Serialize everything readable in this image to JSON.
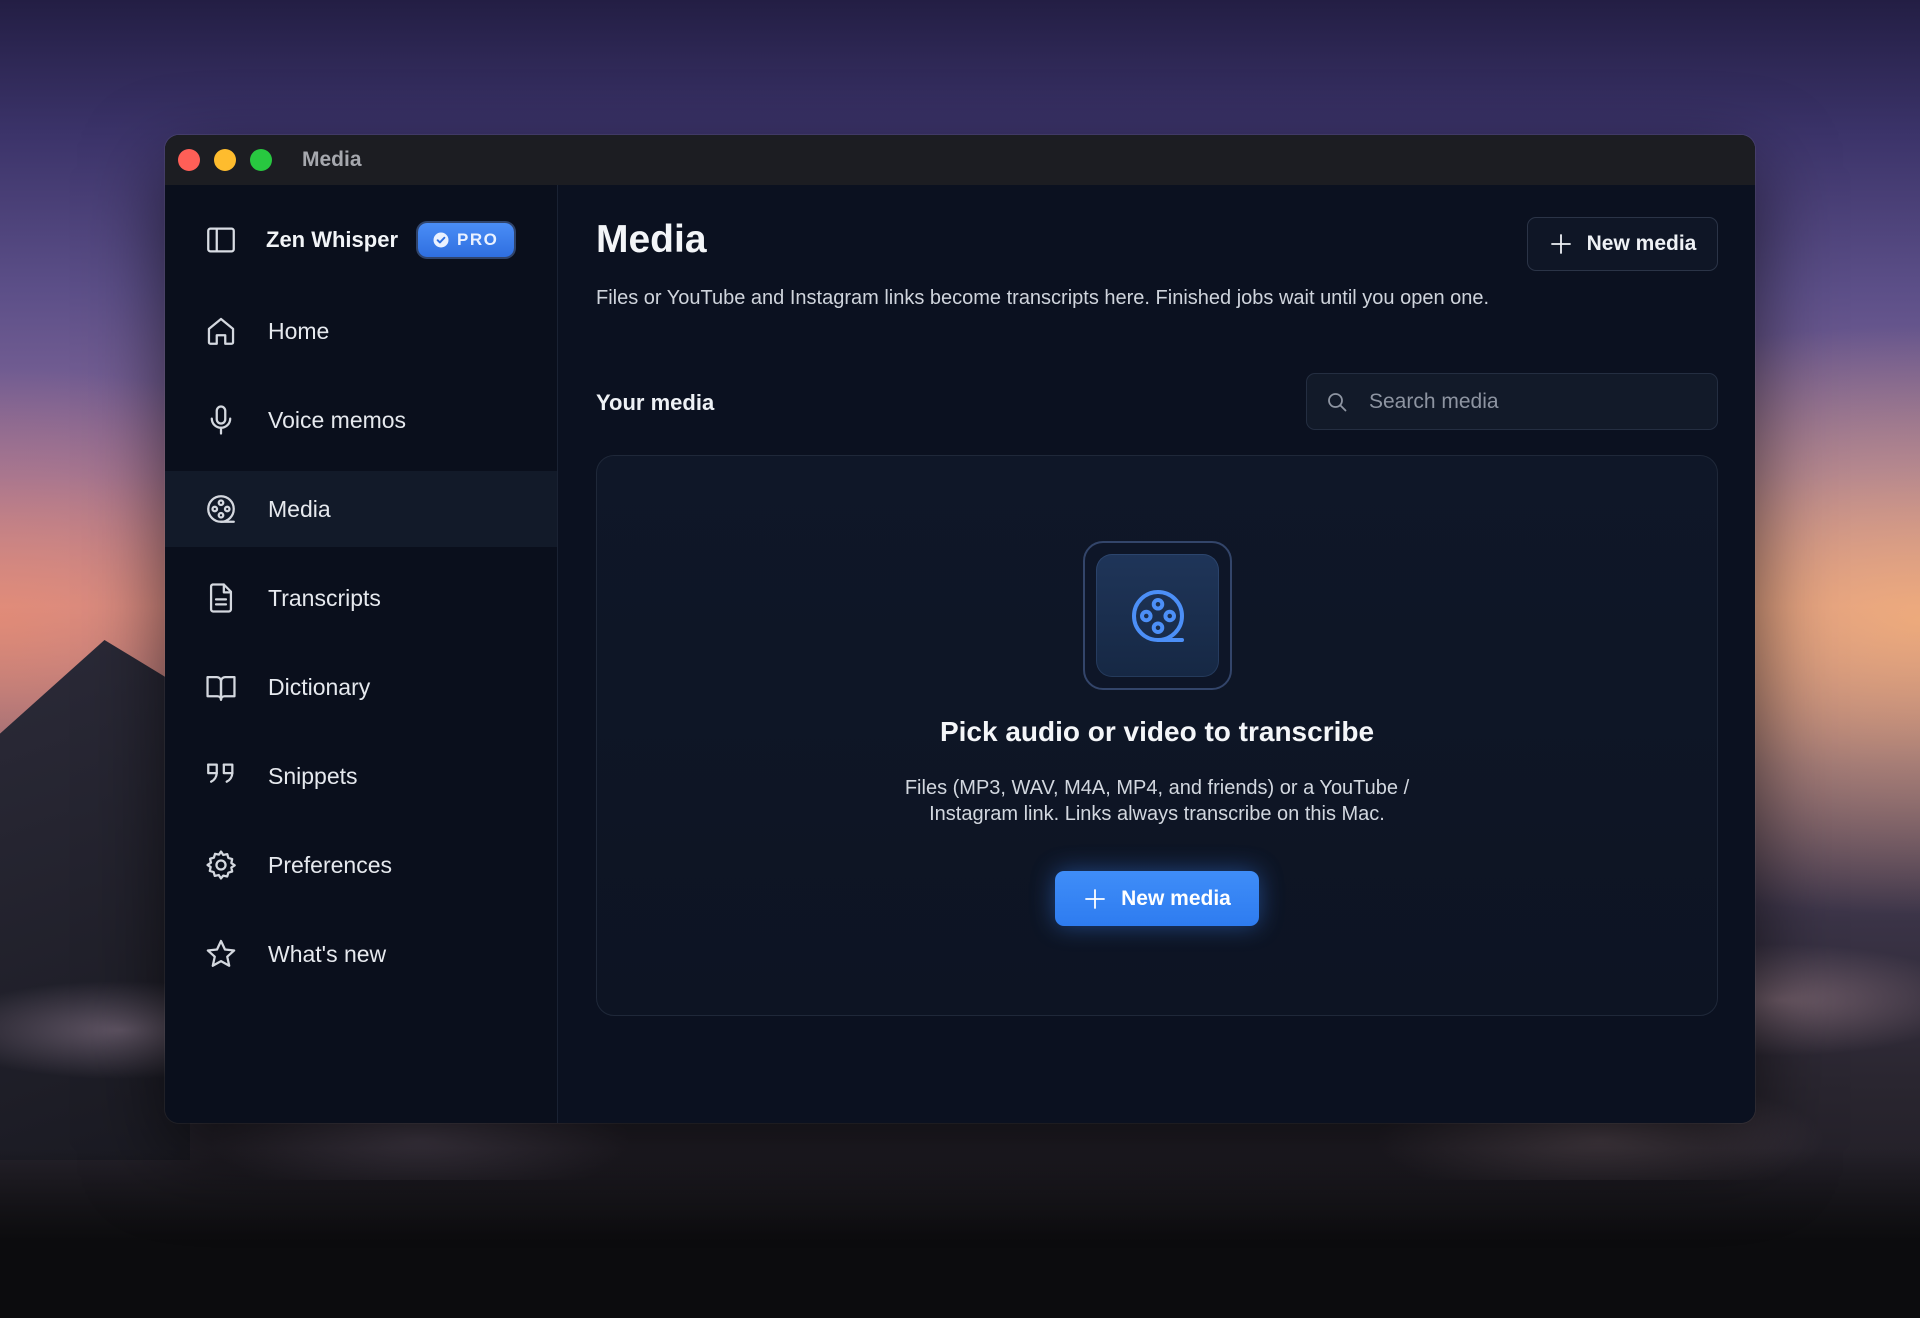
{
  "window": {
    "title": "Media"
  },
  "sidebar": {
    "app_name": "Zen Whisper",
    "badge": "PRO",
    "items": [
      {
        "label": "Home",
        "icon": "home-icon",
        "active": false
      },
      {
        "label": "Voice memos",
        "icon": "microphone-icon",
        "active": false
      },
      {
        "label": "Media",
        "icon": "film-reel-icon",
        "active": true
      },
      {
        "label": "Transcripts",
        "icon": "document-icon",
        "active": false
      },
      {
        "label": "Dictionary",
        "icon": "book-icon",
        "active": false
      },
      {
        "label": "Snippets",
        "icon": "quote-icon",
        "active": false
      },
      {
        "label": "Preferences",
        "icon": "gear-icon",
        "active": false
      },
      {
        "label": "What's new",
        "icon": "star-icon",
        "active": false
      }
    ]
  },
  "main": {
    "title": "Media",
    "description": "Files or YouTube and Instagram links become transcripts here. Finished jobs wait until you open one.",
    "header_button": "New media",
    "section_title": "Your media",
    "search": {
      "placeholder": "Search media",
      "value": ""
    },
    "empty_state": {
      "title": "Pick audio or video to transcribe",
      "description": "Files (MP3, WAV, M4A, MP4, and friends) or a YouTube / Instagram link. Links always transcribe on this Mac.",
      "button": "New media"
    }
  },
  "colors": {
    "accent": "#3f8df8",
    "sidebar_bg": "#0a0f1c",
    "main_bg": "#0b1120",
    "traffic_close": "#ff5f57",
    "traffic_minimize": "#febc2e",
    "traffic_maximize": "#28c840"
  }
}
